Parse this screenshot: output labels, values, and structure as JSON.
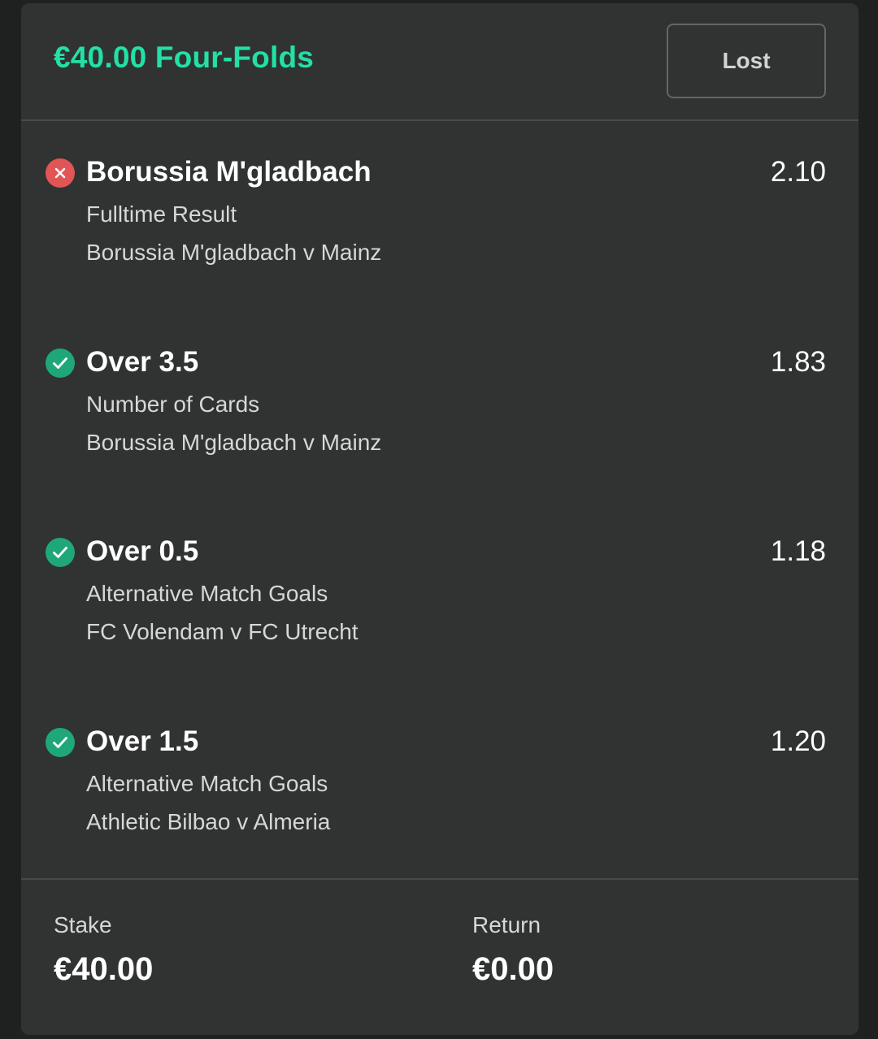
{
  "bet": {
    "title": "€40.00 Four-Folds",
    "status": "Lost"
  },
  "selections": [
    {
      "name": "Borussia M'gladbach",
      "odds": "2.10",
      "market": "Fulltime Result",
      "event": "Borussia M'gladbach v Mainz",
      "result": "lost",
      "icon": "cross-circle-icon"
    },
    {
      "name": "Over 3.5",
      "odds": "1.83",
      "market": "Number of Cards",
      "event": "Borussia M'gladbach v Mainz",
      "result": "won",
      "icon": "check-circle-icon"
    },
    {
      "name": "Over 0.5",
      "odds": "1.18",
      "market": "Alternative Match Goals",
      "event": "FC Volendam v FC Utrecht",
      "result": "won",
      "icon": "check-circle-icon"
    },
    {
      "name": "Over 1.5",
      "odds": "1.20",
      "market": "Alternative Match Goals",
      "event": "Athletic Bilbao v Almeria",
      "result": "won",
      "icon": "check-circle-icon"
    }
  ],
  "footer": {
    "stake_label": "Stake",
    "stake_value": "€40.00",
    "return_label": "Return",
    "return_value": "€0.00"
  },
  "colors": {
    "accent": "#22e0a6",
    "won": "#1fa77a",
    "lost": "#e05556",
    "card_background": "#303332"
  }
}
